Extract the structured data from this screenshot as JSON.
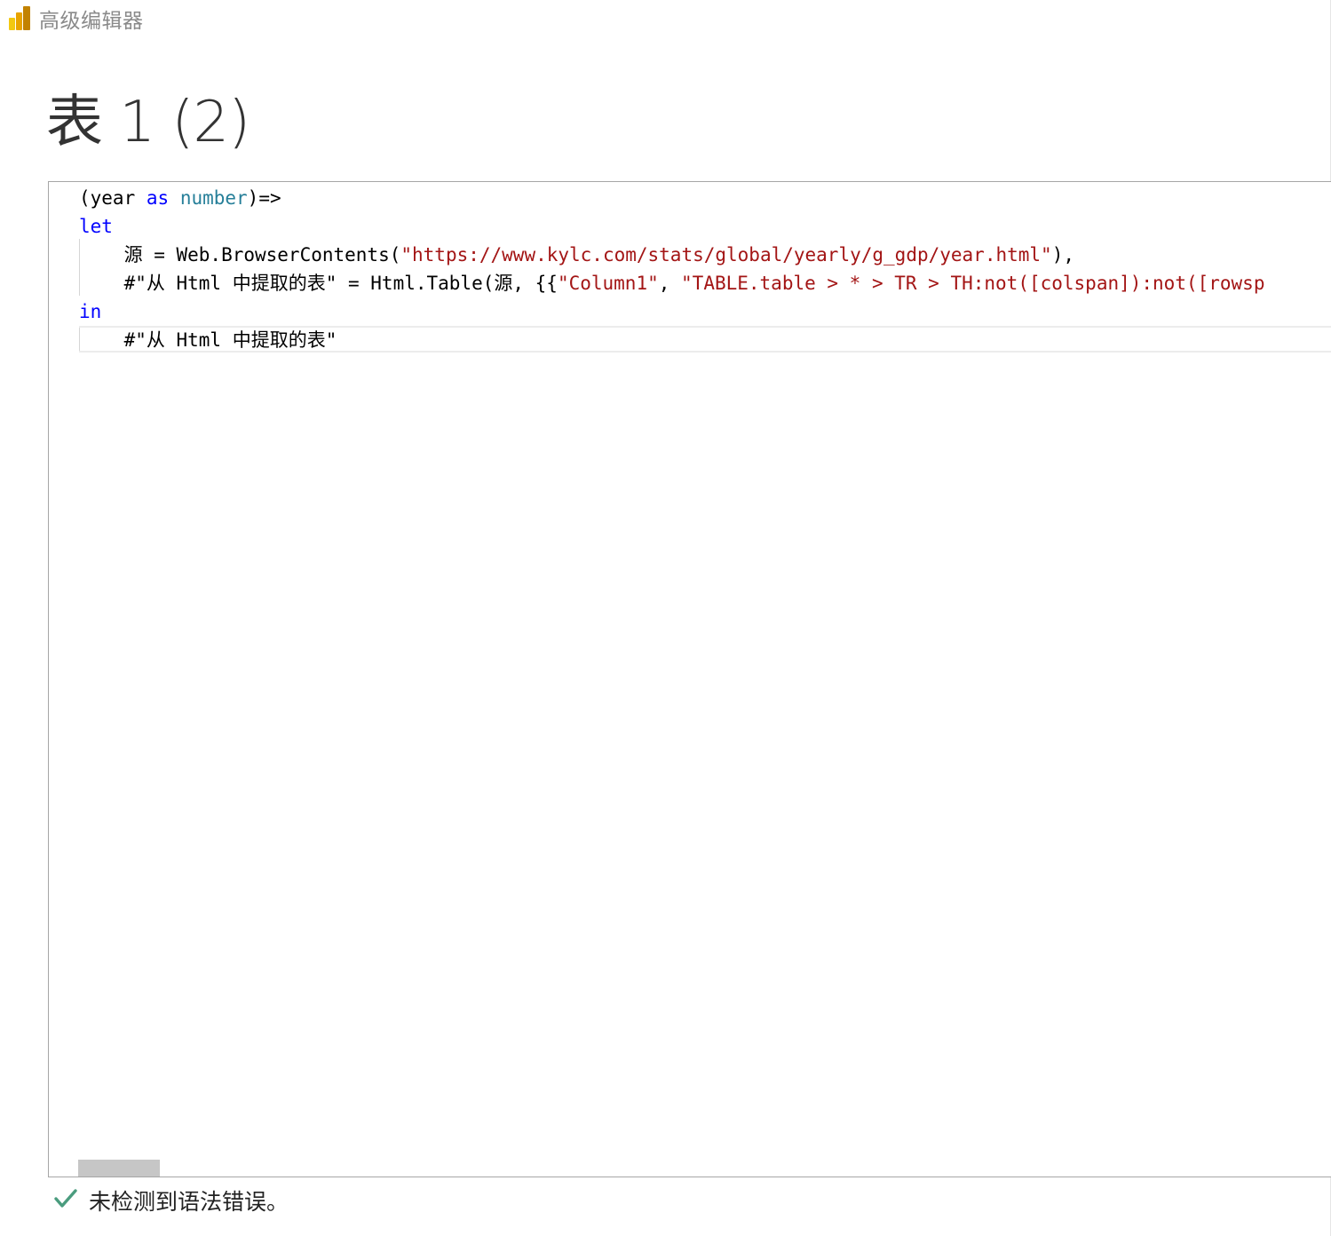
{
  "window": {
    "title": "高级编辑器",
    "logo_icon": "power-bi-logo-icon",
    "logo_colors": [
      "#f2c811",
      "#e8a300",
      "#c28200"
    ]
  },
  "query": {
    "title": "表 1 (2)"
  },
  "editor": {
    "lines": [
      {
        "tokens": [
          {
            "text": "(year ",
            "kind": "plain"
          },
          {
            "text": "as",
            "kind": "keyword"
          },
          {
            "text": " ",
            "kind": "plain"
          },
          {
            "text": "number",
            "kind": "type"
          },
          {
            "text": ")=>",
            "kind": "plain"
          }
        ]
      },
      {
        "tokens": [
          {
            "text": "let",
            "kind": "keyword"
          }
        ]
      },
      {
        "tokens": [
          {
            "text": "    源 = Web.BrowserContents(",
            "kind": "plain"
          },
          {
            "text": "\"https://www.kylc.com/stats/global/yearly/g_gdp/year.html\"",
            "kind": "string"
          },
          {
            "text": "),",
            "kind": "plain"
          }
        ]
      },
      {
        "tokens": [
          {
            "text": "    #\"从 Html 中提取的表\" = Html.Table(源, {{",
            "kind": "plain"
          },
          {
            "text": "\"Column1\"",
            "kind": "string"
          },
          {
            "text": ", ",
            "kind": "plain"
          },
          {
            "text": "\"TABLE.table > * > TR > TH:not([colspan]):not([rowsp",
            "kind": "string"
          }
        ]
      },
      {
        "tokens": [
          {
            "text": "in",
            "kind": "keyword"
          }
        ]
      },
      {
        "tokens": [
          {
            "text": "    #\"从 Html 中提取的表\"",
            "kind": "plain"
          }
        ]
      }
    ],
    "colors": {
      "keyword": "#0000ff",
      "type": "#267f99",
      "string": "#a31515",
      "plain": "#000000"
    }
  },
  "status": {
    "icon": "checkmark-icon",
    "icon_color": "#4a9c7e",
    "text": "未检测到语法错误。"
  }
}
